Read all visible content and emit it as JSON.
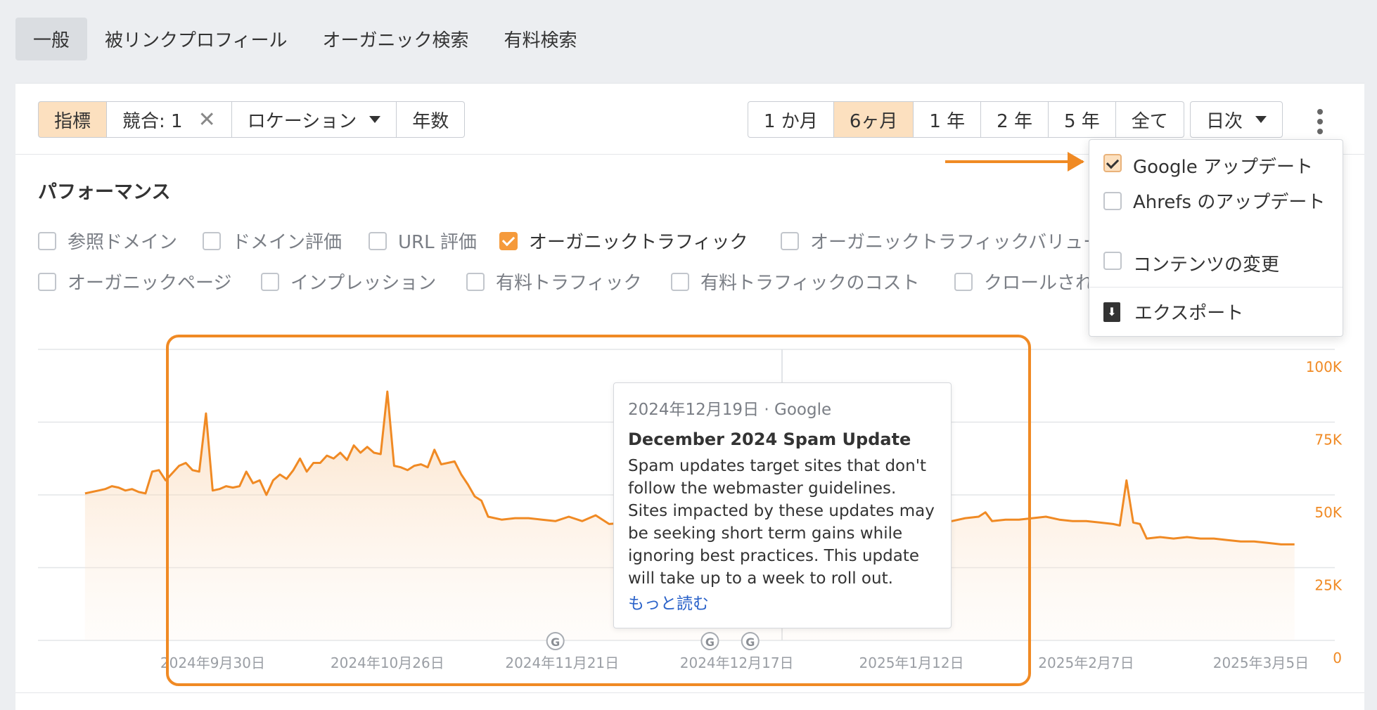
{
  "top_tabs": [
    {
      "label": "一般",
      "active": true
    },
    {
      "label": "被リンクプロフィール",
      "active": false
    },
    {
      "label": "オーガニック検索",
      "active": false
    },
    {
      "label": "有料検索",
      "active": false
    }
  ],
  "filters": {
    "metrics": "指標",
    "competitors": "競合: 1",
    "clear_symbol": "✕",
    "location": "ロケーション",
    "years": "年数"
  },
  "ranges": [
    {
      "label": "1 か月",
      "active": false
    },
    {
      "label": "6ヶ月",
      "active": true
    },
    {
      "label": "1 年",
      "active": false
    },
    {
      "label": "2 年",
      "active": false
    },
    {
      "label": "5 年",
      "active": false
    },
    {
      "label": "全て",
      "active": false
    }
  ],
  "granularity": "日次",
  "performance_title": "パフォーマンス",
  "metric_rows": [
    [
      {
        "label": "参照ドメイン",
        "checked": false
      },
      {
        "label": "ドメイン評価",
        "checked": false
      },
      {
        "label": "URL 評価",
        "checked": false
      },
      {
        "label": "オーガニックトラフィック",
        "checked": true
      },
      {
        "label": "オーガニックトラフィックバリュー",
        "checked": false
      }
    ],
    [
      {
        "label": "オーガニックページ",
        "checked": false
      },
      {
        "label": "インプレッション",
        "checked": false
      },
      {
        "label": "有料トラフィック",
        "checked": false
      },
      {
        "label": "有料トラフィックのコスト",
        "checked": false
      },
      {
        "label": "クロールされたページ",
        "checked": false
      }
    ]
  ],
  "menu": {
    "items": [
      {
        "label": "Google アップデート",
        "checked": true
      },
      {
        "label": "Ahrefs のアップデート",
        "checked": false
      },
      {
        "label": "コンテンツの変更",
        "checked": false
      }
    ],
    "export": "エクスポート"
  },
  "tooltip": {
    "date": "2024年12月19日 · Google",
    "title": "December 2024 Spam Update",
    "body": "Spam updates target sites that don't follow the webmaster guidelines. Sites impacted by these updates may be seeking short term gains while ignoring best practices. This update will take up to a week to roll out.",
    "link": "もっと読む"
  },
  "colors": {
    "series": "#f08a24",
    "highlight": "#f08a24",
    "active_bg": "#fce0bf"
  },
  "chart_data": {
    "type": "area",
    "title": "",
    "xlabel": "",
    "ylabel": "",
    "y_axis_side": "right",
    "ylim": [
      0,
      100000
    ],
    "yticks": [
      {
        "value": 100000,
        "label": "100K"
      },
      {
        "value": 75000,
        "label": "75K"
      },
      {
        "value": 50000,
        "label": "50K"
      },
      {
        "value": 25000,
        "label": "25K"
      },
      {
        "value": 0,
        "label": "0"
      }
    ],
    "xlim": [
      "2024-09-04",
      "2025-03-16"
    ],
    "xticks": [
      {
        "date": "2024-09-30",
        "label": "2024年9月30日"
      },
      {
        "date": "2024-10-26",
        "label": "2024年10月26日"
      },
      {
        "date": "2024-11-21",
        "label": "2024年11月21日"
      },
      {
        "date": "2024-12-17",
        "label": "2024年12月17日"
      },
      {
        "date": "2025-01-12",
        "label": "2025年1月12日"
      },
      {
        "date": "2025-02-07",
        "label": "2025年2月7日"
      },
      {
        "date": "2025-03-05",
        "label": "2025年3月5日"
      }
    ],
    "grid": true,
    "update_markers": [
      {
        "date": "2024-11-20",
        "label": "G"
      },
      {
        "date": "2024-12-13",
        "label": "G"
      },
      {
        "date": "2024-12-19",
        "label": "G"
      }
    ],
    "highlight_range": [
      "2024-09-13",
      "2025-01-25"
    ],
    "series": [
      {
        "name": "オーガニックトラフィック",
        "x": [
          "2024-09-11",
          "2024-09-13",
          "2024-09-14",
          "2024-09-15",
          "2024-09-16",
          "2024-09-17",
          "2024-09-18",
          "2024-09-19",
          "2024-09-20",
          "2024-09-21",
          "2024-09-22",
          "2024-09-23",
          "2024-09-24",
          "2024-09-25",
          "2024-09-26",
          "2024-09-27",
          "2024-09-28",
          "2024-09-29",
          "2024-09-30",
          "2024-10-01",
          "2024-10-02",
          "2024-10-03",
          "2024-10-04",
          "2024-10-05",
          "2024-10-06",
          "2024-10-07",
          "2024-10-08",
          "2024-10-09",
          "2024-10-10",
          "2024-10-11",
          "2024-10-12",
          "2024-10-13",
          "2024-10-14",
          "2024-10-15",
          "2024-10-16",
          "2024-10-17",
          "2024-10-18",
          "2024-10-19",
          "2024-10-20",
          "2024-10-21",
          "2024-10-22",
          "2024-10-23",
          "2024-10-24",
          "2024-10-25",
          "2024-10-26",
          "2024-10-27",
          "2024-10-28",
          "2024-10-29",
          "2024-10-30",
          "2024-10-31",
          "2024-11-01",
          "2024-11-02",
          "2024-11-03",
          "2024-11-04",
          "2024-11-05",
          "2024-11-06",
          "2024-11-07",
          "2024-11-08",
          "2024-11-09",
          "2024-11-10",
          "2024-11-12",
          "2024-11-14",
          "2024-11-16",
          "2024-11-18",
          "2024-11-20",
          "2024-11-22",
          "2024-11-24",
          "2024-11-26",
          "2024-11-27",
          "2024-11-28",
          "2024-12-01",
          "2024-12-05",
          "2024-12-10",
          "2024-12-15",
          "2024-12-20",
          "2024-12-26",
          "2024-12-31",
          "2025-01-04",
          "2025-01-06",
          "2025-01-08",
          "2025-01-10",
          "2025-01-12",
          "2025-01-14",
          "2025-01-16",
          "2025-01-18",
          "2025-01-20",
          "2025-01-22",
          "2025-01-23",
          "2025-01-24",
          "2025-01-26",
          "2025-01-28",
          "2025-01-30",
          "2025-02-01",
          "2025-02-03",
          "2025-02-05",
          "2025-02-07",
          "2025-02-09",
          "2025-02-11",
          "2025-02-12",
          "2025-02-13",
          "2025-02-14",
          "2025-02-15",
          "2025-02-16",
          "2025-02-18",
          "2025-02-20",
          "2025-02-22",
          "2025-02-24",
          "2025-02-26",
          "2025-02-28",
          "2025-03-02",
          "2025-03-04",
          "2025-03-06",
          "2025-03-08",
          "2025-03-10"
        ],
        "values": [
          50500,
          51500,
          52000,
          53000,
          52500,
          51500,
          52000,
          51000,
          50500,
          58000,
          58500,
          55000,
          57500,
          60000,
          61000,
          58500,
          58000,
          78000,
          51500,
          52000,
          53000,
          52500,
          53000,
          58000,
          54000,
          55000,
          50000,
          55000,
          57000,
          55500,
          58500,
          62500,
          58000,
          61000,
          61000,
          63500,
          62500,
          64500,
          62000,
          67000,
          64500,
          66500,
          64500,
          64000,
          85500,
          60000,
          59500,
          58500,
          60000,
          60500,
          59500,
          65500,
          60500,
          61000,
          61500,
          57000,
          53500,
          49500,
          48000,
          42500,
          41500,
          42000,
          42000,
          41500,
          41000,
          42500,
          41000,
          43000,
          41500,
          40000,
          40500,
          40500,
          40000,
          40500,
          41000,
          42000,
          43000,
          38000,
          37500,
          38500,
          39000,
          39500,
          40000,
          40500,
          41000,
          42000,
          42500,
          44000,
          41000,
          41500,
          41500,
          42000,
          42500,
          41500,
          41000,
          41000,
          40500,
          40000,
          39500,
          55000,
          40500,
          40000,
          35000,
          35500,
          35000,
          35500,
          35000,
          35000,
          34500,
          34000,
          34000,
          33500,
          33000,
          33000
        ]
      }
    ]
  }
}
